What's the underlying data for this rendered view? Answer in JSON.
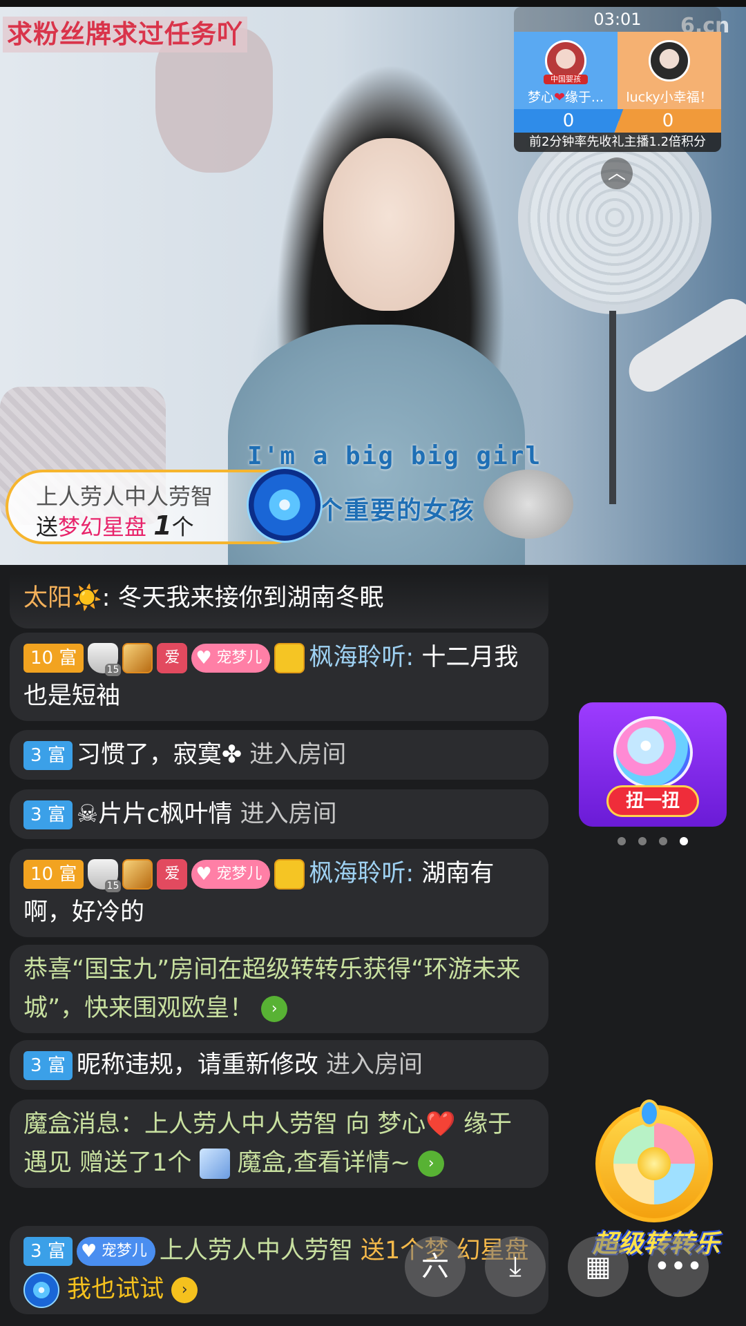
{
  "stream": {
    "title_banner": "求粉丝牌求过任务吖",
    "watermark": "6.cn",
    "lyric_en": "I'm a big big girl",
    "lyric_cn": "个重要的女孩"
  },
  "pk": {
    "timer": "03:01",
    "left_avatar_tag": "中国婴孩",
    "left_name_a": "梦心",
    "left_name_b": "缘于...",
    "right_name": "lucky小幸福！",
    "left_score": "0",
    "right_score": "0",
    "note": "前2分钟率先收礼主播1.2倍积分",
    "collapse_icon": "chevron-up-icon"
  },
  "gift_banner": {
    "user": "上人劳人中人劳智",
    "send_word": "送",
    "gift_name": "梦幻星盘",
    "count": "1",
    "unit": "个"
  },
  "chat": [
    {
      "user": "太阳☀️",
      "text": ": 冬天我来接你到湖南冬眠"
    },
    {
      "level": "10",
      "level_suffix": "富",
      "love": "爱",
      "club": "宠梦儿",
      "user": "枫海聆听:",
      "text": " 十二月我也是短袖"
    },
    {
      "level": "3",
      "level_suffix": "富",
      "user": "习惯了，寂寞✤",
      "action": " 进入房间"
    },
    {
      "level": "3",
      "level_suffix": "富",
      "user": "☠片片c枫叶情",
      "action": " 进入房间"
    },
    {
      "level": "10",
      "level_suffix": "富",
      "love": "爱",
      "club": "宠梦儿",
      "user": "枫海聆听:",
      "text": " 湖南有啊，好冷的"
    },
    {
      "text": "恭喜“国宝九”房间在超级转转乐获得“环游未来城”，快来围观欧皇！"
    },
    {
      "level": "3",
      "level_suffix": "富",
      "user": "昵称违规，请重新修改",
      "action": " 进入房间"
    },
    {
      "text_a": "魔盒消息：上人劳人中人劳智 向 梦心❤️",
      "text_b": "缘于遇见 赠送了1个",
      "text_c": " 魔盒,查看详情~"
    },
    {
      "level": "3",
      "level_suffix": "富",
      "club": "宠梦儿",
      "user": "上人劳人中人劳智",
      "action": " 送1个梦",
      "text": "幻星盘",
      "cta": "我也试试"
    }
  ],
  "ad": {
    "button": "扭一扭",
    "pages": 4,
    "active_page": 4
  },
  "wheel": {
    "label": "超级转转乐"
  },
  "fabs": [
    "share-icon",
    "download-icon",
    "grid-icon",
    "more-icon"
  ]
}
